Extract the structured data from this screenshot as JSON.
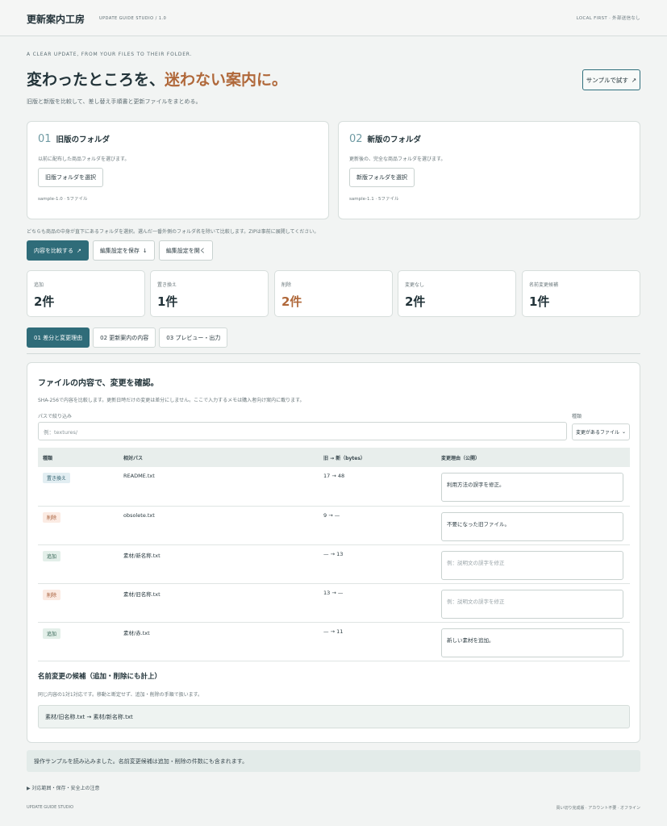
{
  "header": {
    "brand": "更新案内工房",
    "brand_sub": "UPDATE GUIDE STUDIO / 1.0",
    "right_note": "LOCAL FIRST · 外部送信なし"
  },
  "hero": {
    "tagline": "A CLEAR UPDATE, FROM YOUR FILES TO THEIR FOLDER.",
    "headline_main": "変わったところを、",
    "headline_accent": "迷わない案内に。",
    "subhead": "旧版と新版を比較して、差し替え手順書と更新ファイルをまとめる。",
    "sample_button": "サンプルで試す",
    "sample_icon": "arrow-up-right-icon"
  },
  "folders": [
    {
      "num": "01",
      "title": "旧版のフォルダ",
      "desc": "以前に配布した商品フォルダを選びます。",
      "button": "旧版フォルダを選択",
      "meta": "sample-1.0 · 5ファイル"
    },
    {
      "num": "02",
      "title": "新版のフォルダ",
      "desc": "更新後の、完全な商品フォルダを選びます。",
      "button": "新版フォルダを選択",
      "meta": "sample-1.1 · 5ファイル"
    }
  ],
  "note": "どちらも商品の中身が直下にあるフォルダを選択。選んだ一番外側のフォルダ名を除いて比較します。ZIPは事前に展開してください。",
  "actions": {
    "compare": "内容を比較する",
    "compare_icon": "↗",
    "save": "編集設定を保存",
    "save_icon": "↓",
    "open": "編集設定を開く"
  },
  "stats": [
    {
      "label": "追加",
      "value": "2件",
      "color": "#23343a"
    },
    {
      "label": "置き換え",
      "value": "1件",
      "color": "#23343a"
    },
    {
      "label": "削除",
      "value": "2件",
      "color": "#b0683a"
    },
    {
      "label": "変更なし",
      "value": "2件",
      "color": "#23343a"
    },
    {
      "label": "名前変更候補",
      "value": "1件",
      "color": "#23343a"
    }
  ],
  "tabs": [
    "01 差分と変更理由",
    "02 更新案内の内容",
    "03 プレビュー・出力"
  ],
  "diff": {
    "title": "ファイルの内容で、変更を確認。",
    "desc": "SHA-256で内容を比較します。更新日時だけの変更は差分にしません。ここで入力するメモは購入者向け案内に載ります。",
    "filter_label": "パスで絞り込み",
    "filter_placeholder": "例：textures/",
    "kind_label": "種類",
    "kind_value": "変更があるファイル",
    "columns": [
      "種類",
      "相対パス",
      "旧 → 新（bytes）",
      "変更理由（公開）"
    ],
    "rows": [
      {
        "kind": "置き換え",
        "path": "README.txt",
        "size": "17 → 48",
        "reason": "利用方法の誤字を修正。",
        "placeholder": ""
      },
      {
        "kind": "削除",
        "path": "obsolete.txt",
        "size": "9 → —",
        "reason": "不要になった旧ファイル。",
        "placeholder": ""
      },
      {
        "kind": "追加",
        "path": "素材/新名称.txt",
        "size": "— → 13",
        "reason": "",
        "placeholder": "例：説明文の誤字を修正"
      },
      {
        "kind": "削除",
        "path": "素材/旧名称.txt",
        "size": "13 → —",
        "reason": "",
        "placeholder": "例：説明文の誤字を修正"
      },
      {
        "kind": "追加",
        "path": "素材/赤.txt",
        "size": "— → 11",
        "reason": "新しい素材を追加。",
        "placeholder": ""
      }
    ],
    "rename_title": "名前変更の候補（追加・削除にも計上）",
    "rename_desc": "同じ内容の1対1対応です。移動と断定せず、追加・削除の手順で扱います。",
    "rename_item": "素材/旧名称.txt → 素材/新名称.txt"
  },
  "status": "操作サンプルを読み込みました。名前変更候補は追加・削除の件数にも含まれます。",
  "details": "▶ 対応範囲・保存・安全上の注意",
  "footer": {
    "left": "UPDATE GUIDE STUDIO",
    "right": "買い切り完成版 · アカウント不要 · オフライン"
  }
}
